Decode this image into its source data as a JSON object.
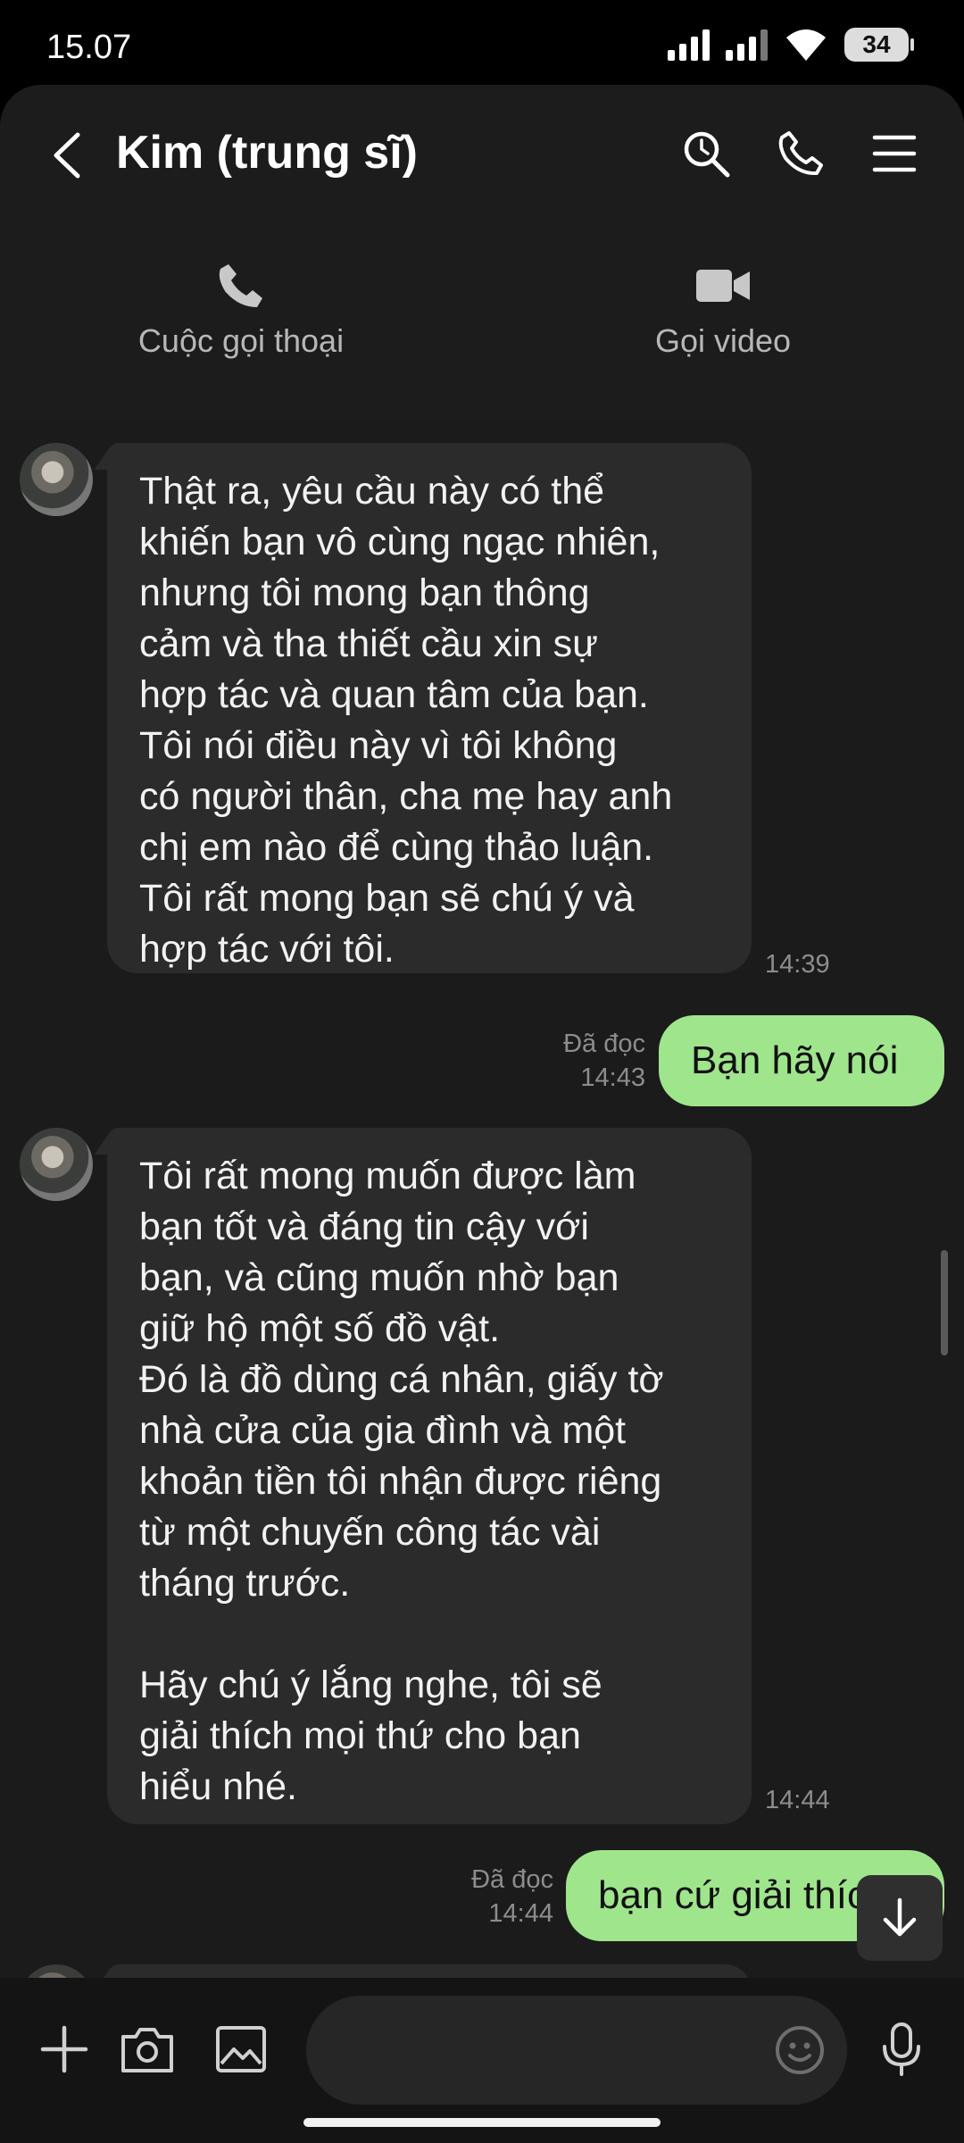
{
  "status_bar": {
    "time": "15.07",
    "battery": "34"
  },
  "header": {
    "back_icon": "chevron-left-icon",
    "title": "Kim (trung sĩ)",
    "icons": [
      "search-icon",
      "phone-icon",
      "menu-icon"
    ]
  },
  "call_actions": [
    {
      "label": "Cuộc gọi thoại",
      "icon": "phone-icon"
    },
    {
      "label": "Gọi video",
      "icon": "video-icon"
    }
  ],
  "messages": [
    {
      "direction": "in",
      "text": "Thật ra, yêu cầu này có thể\nkhiến bạn vô cùng ngạc nhiên,\nnhưng tôi mong bạn thông\ncảm và tha thiết cầu xin sự\nhợp tác và quan tâm của bạn.\nTôi nói điều này vì tôi không\ncó người thân, cha mẹ hay anh\nchị em nào để cùng thảo luận.\nTôi rất mong bạn sẽ chú ý và\nhợp tác với tôi.",
      "time": "14:39"
    },
    {
      "direction": "out",
      "text": "Bạn hãy nói",
      "status": "Đã đọc",
      "time": "14:43"
    },
    {
      "direction": "in",
      "text": "Tôi rất mong muốn được làm\nbạn tốt và đáng tin cậy với\nbạn, và cũng muốn nhờ bạn\ngiữ hộ một số đồ vật.\nĐó là đồ dùng cá nhân, giấy tờ\nnhà cửa của gia đình và một\nkhoản tiền tôi nhận được riêng\ntừ một chuyến công tác vài\ntháng trước.\n\nHãy chú ý lắng nghe, tôi sẽ\ngiải thích mọi thứ cho bạn\nhiểu nhé.",
      "time": "14:44"
    },
    {
      "direction": "out",
      "text": "bạn cứ giải thích",
      "status": "Đã đọc",
      "time": "14:44"
    }
  ],
  "composer": {
    "placeholder": "",
    "icons": [
      "plus-icon",
      "camera-icon",
      "image-icon",
      "emoji-icon",
      "microphone-icon"
    ]
  },
  "colors": {
    "background": "#1b1b1b",
    "incoming_bubble": "#2b2b2b",
    "outgoing_bubble": "#9fe58c",
    "header": "#1c1c1c"
  }
}
